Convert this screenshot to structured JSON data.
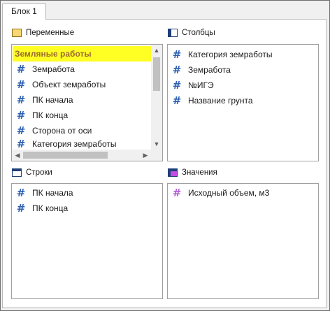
{
  "tab": {
    "label": "Блок 1"
  },
  "variables": {
    "title": "Переменные",
    "items": [
      "Земляные работы",
      "Земработа",
      "Объект земработы",
      "ПК начала",
      "ПК конца",
      "Сторона от оси",
      "Категория земработы"
    ]
  },
  "columns": {
    "title": "Столбцы",
    "items": [
      "Категория земработы",
      "Земработа",
      "№ИГЭ",
      "Название грунта"
    ]
  },
  "rows": {
    "title": "Строки",
    "items": [
      "ПК начала",
      "ПК конца"
    ]
  },
  "values": {
    "title": "Значения",
    "items": [
      "Исходный объем, м3"
    ]
  },
  "colors": {
    "selection": "#ffff24",
    "hash_blue": "#2a5db0",
    "hash_purple": "#b05ad6"
  }
}
